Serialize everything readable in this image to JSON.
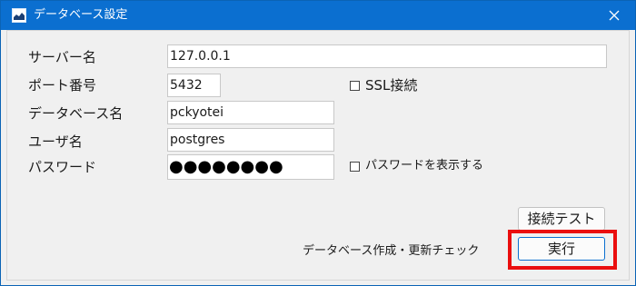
{
  "window": {
    "title": "データベース設定",
    "titlebar_color": "#0b6fd0"
  },
  "form": {
    "server_label": "サーバー名",
    "server_value": "127.0.0.1",
    "port_label": "ポート番号",
    "port_value": "5432",
    "ssl_checkbox_label": "SSL接続",
    "ssl_checked": false,
    "database_label": "データベース名",
    "database_value": "pckyotei",
    "user_label": "ユーザ名",
    "user_value": "postgres",
    "password_label": "パスワード",
    "password_masked": "●●●●●●●●",
    "show_password_label": "パスワードを表示する",
    "show_password_checked": false
  },
  "actions": {
    "test_connection_label": "接続テスト",
    "status_text": "データベース作成・更新チェック",
    "execute_label": "実行"
  },
  "annotation": {
    "highlight_color": "#ea0e0e"
  }
}
